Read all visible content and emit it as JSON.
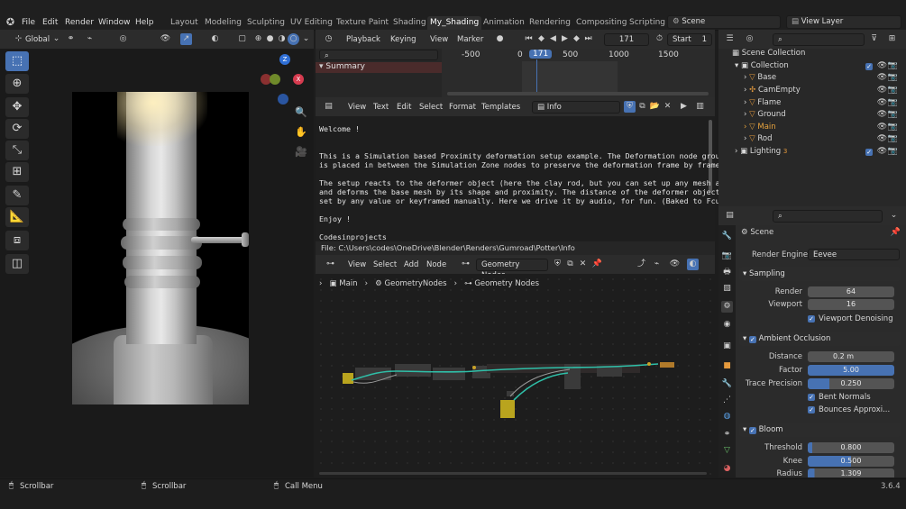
{
  "menu": {
    "file": "File",
    "edit": "Edit",
    "render": "Render",
    "window": "Window",
    "help": "Help"
  },
  "workspaces": [
    "Layout",
    "Modeling",
    "Sculpting",
    "UV Editing",
    "Texture Paint",
    "Shading",
    "My_Shading",
    "Animation",
    "Rendering",
    "Compositing",
    "Scripting"
  ],
  "scene_name": "Scene",
  "view_layer": "View Layer",
  "viewport": {
    "orientation": "Global",
    "axis_x": "X",
    "axis_y": "Y",
    "axis_z": "Z"
  },
  "timeline": {
    "playback": "Playback",
    "keying": "Keying",
    "view": "View",
    "marker": "Marker",
    "current_frame": "171",
    "start_label": "Start",
    "start_value": "1",
    "summary": "Summary",
    "ruler": [
      "-500",
      "0",
      "171",
      "500",
      "1000",
      "1500"
    ]
  },
  "text_editor": {
    "view": "View",
    "text": "Text",
    "edit": "Edit",
    "select": "Select",
    "format": "Format",
    "templates": "Templates",
    "file_name": "Info",
    "file_path": "File: C:\\Users\\codes\\OneDrive\\Blender\\Renders\\Gumroad\\Potter\\Info",
    "lines": [
      "Welcome !",
      "",
      "",
      "This is a Simulation based Proximity deformation setup example. The Deformation node group",
      "is placed in between the Simulation Zone nodes to preserve the deformation frame by frame.",
      "",
      "The setup reacts to the deformer object (here the clay rod, but you can set up any mesh as",
      "and deforms the base mesh by its shape and proximity. The distance of the deformer object ca",
      "set by any value or keyframed manually. Here we drive it by audio, for fun. (Baked to Fcurv",
      "",
      "Enjoy !",
      "",
      "Codesinprojects"
    ]
  },
  "node_editor": {
    "view": "View",
    "select": "Select",
    "add": "Add",
    "node": "Node",
    "tree_type": "Geometry Nodes",
    "breadcrumb": [
      "Main",
      "GeometryNodes",
      "Geometry Nodes"
    ]
  },
  "outliner": {
    "scene_collection": "Scene Collection",
    "collection": "Collection",
    "items": [
      "Base",
      "CamEmpty",
      "Flame",
      "Ground",
      "Main",
      "Rod"
    ],
    "lighting": "Lighting",
    "lighting_count": "3"
  },
  "properties": {
    "scene": "Scene",
    "render_engine_label": "Render Engine",
    "render_engine": "Eevee",
    "sampling": {
      "title": "Sampling",
      "render_label": "Render",
      "render_value": "64",
      "viewport_label": "Viewport",
      "viewport_value": "16",
      "denoise": "Viewport Denoising"
    },
    "ao": {
      "title": "Ambient Occlusion",
      "distance_label": "Distance",
      "distance_value": "0.2 m",
      "factor_label": "Factor",
      "factor_value": "5.00",
      "trace_label": "Trace Precision",
      "trace_value": "0.250",
      "bent_normals": "Bent Normals",
      "bounces": "Bounces Approxi..."
    },
    "bloom": {
      "title": "Bloom",
      "threshold_label": "Threshold",
      "threshold_value": "0.800",
      "knee_label": "Knee",
      "knee_value": "0.500",
      "radius_label": "Radius",
      "radius_value": "1.309"
    }
  },
  "status": {
    "left": "Scrollbar",
    "middle": "Scrollbar",
    "right": "Call Menu",
    "version": "3.6.4"
  }
}
